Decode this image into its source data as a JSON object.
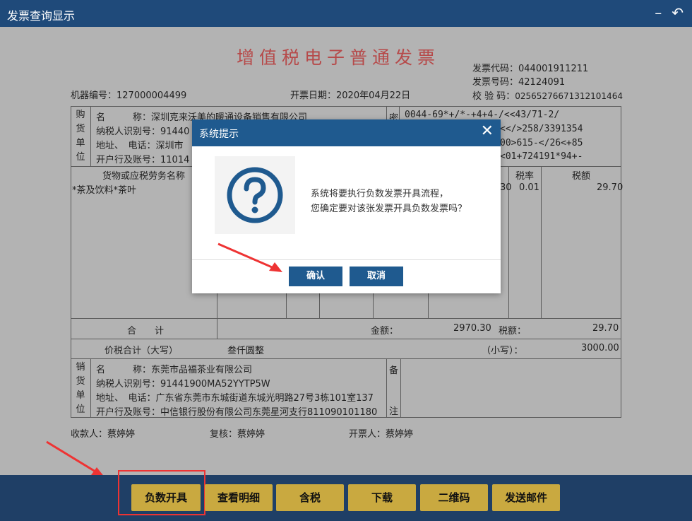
{
  "window": {
    "title": "发票查询显示",
    "minimize_icon": "minimize-icon",
    "back_icon": "back-icon"
  },
  "invoice": {
    "title": "增值税电子普通发票",
    "code_label": "发票代码：",
    "code": "044001911211",
    "number_label": "发票号码：",
    "number": "42124091",
    "check_label": "校 验 码：",
    "check": "02565276671312101464",
    "machine_label": "机器编号：",
    "machine": "127000004499",
    "date_label": "开票日期：",
    "date": "2020年04月22日",
    "buyer": {
      "side": [
        "购",
        "货",
        "单",
        "位"
      ],
      "name_label": "名　　　称：",
      "name": "深圳克来沃美的暖通设备销售有限公司",
      "tax_label": "纳税人识别号：",
      "tax": "91440",
      "addr_label": "地址、　电话：",
      "addr": "深圳市",
      "bank_label": "开户行及账号：",
      "bank": "11014"
    },
    "cipher_side": "密",
    "cipher": [
      "0044-69*+/*-+4+4-/<<43/71-2/",
      "<</>258/3391354",
      "00>615-</26<+85",
      "<01+724191*94+-"
    ],
    "items_header": {
      "name": "货物或应税劳务名称",
      "rate": "税率",
      "tax": "税额"
    },
    "items": [
      {
        "name": "*茶及饮料*茶叶",
        "amount_tail": "30",
        "rate": "0.01",
        "tax": "29.70"
      }
    ],
    "total_label": "合　　计",
    "amount_label": "金额：",
    "amount": "2970.30",
    "tax_total_label": "税额：",
    "tax_total": "29.70",
    "grand_label": "价税合计（大写）",
    "grand_words": "叁仟圆整",
    "small_label": "（小写）：",
    "grand_small": "3000.00",
    "seller": {
      "side": [
        "销",
        "货",
        "单",
        "位"
      ],
      "name_label": "名　　　称：",
      "name": "东莞市品福茶业有限公司",
      "tax_label": "纳税人识别号：",
      "tax": "91441900MA52YYTP5W",
      "addr_label": "地址、　电话：",
      "addr": "广东省东莞市东城街道东城光明路27号3栋101室137",
      "bank_label": "开户行及账号：",
      "bank": "中信银行股份有限公司东莞星河支行811090101180"
    },
    "note_side": [
      "备",
      "注"
    ],
    "payee_label": "收款人：",
    "payee": "蔡婷婷",
    "reviewer_label": "复核：",
    "reviewer": "蔡婷婷",
    "issuer_label": "开票人：",
    "issuer": "蔡婷婷"
  },
  "dialog": {
    "title": "系统提示",
    "close_icon": "close-icon",
    "icon": "question-icon",
    "message_line1": "系统将要执行负数发票开具流程，",
    "message_line2": "您确定要对该张发票开具负数发票吗？",
    "confirm": "确认",
    "cancel": "取消"
  },
  "toolbar": {
    "negative": "负数开具",
    "details": "查看明细",
    "tax_incl": "含税",
    "download": "下载",
    "qrcode": "二维码",
    "email": "发送邮件"
  },
  "colors": {
    "titlebar": "#1f4a7a",
    "dialog_accent": "#1f5a8f",
    "button_gold": "#c9a940",
    "arrow_red": "#e33"
  }
}
